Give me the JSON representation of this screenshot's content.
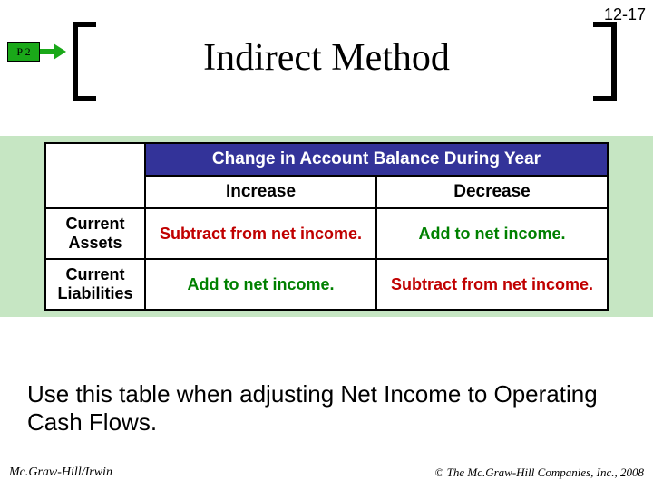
{
  "page_number": "12-17",
  "badge": "P 2",
  "title": "Indirect Method",
  "table": {
    "header_main": "Change in Account Balance During Year",
    "header_sub": [
      "Increase",
      "Decrease"
    ],
    "rows": [
      {
        "label": "Current Assets",
        "increase": "Subtract from net income.",
        "decrease": "Add to net income."
      },
      {
        "label": "Current Liabilities",
        "increase": "Add to net income.",
        "decrease": "Subtract from net income."
      }
    ]
  },
  "caption": "Use this table when adjusting Net Income to Operating Cash Flows.",
  "footer_left": "Mc.Graw-Hill/Irwin",
  "footer_right": "© The Mc.Graw-Hill Companies, Inc., 2008"
}
